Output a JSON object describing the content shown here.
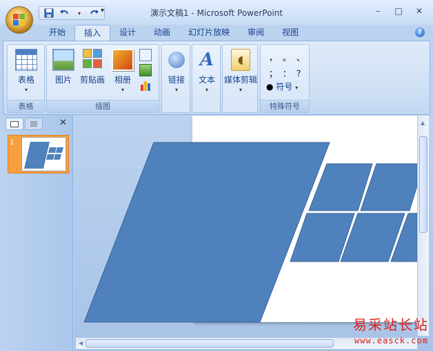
{
  "window": {
    "title": "演示文稿1 - Microsoft PowerPoint",
    "controls": {
      "minimize": "–",
      "maximize": "□",
      "close": "✕"
    }
  },
  "quick_access": {
    "more": "▾"
  },
  "tabs": [
    {
      "label": "开始"
    },
    {
      "label": "插入",
      "active": true
    },
    {
      "label": "设计"
    },
    {
      "label": "动画"
    },
    {
      "label": "幻灯片放映"
    },
    {
      "label": "审阅"
    },
    {
      "label": "视图"
    }
  ],
  "help_label": "?",
  "ribbon": {
    "groups": [
      {
        "label": "表格",
        "buttons": [
          {
            "label": "表格",
            "icon": "table-icon"
          }
        ]
      },
      {
        "label": "插图",
        "buttons": [
          {
            "label": "图片",
            "icon": "picture-icon"
          },
          {
            "label": "剪贴画",
            "icon": "clipart-icon"
          },
          {
            "label": "相册",
            "icon": "album-icon"
          }
        ]
      },
      {
        "label": "",
        "buttons": [
          {
            "label": "链接",
            "icon": "link-icon"
          }
        ]
      },
      {
        "label": "",
        "buttons": [
          {
            "label": "文本",
            "icon": "text-icon"
          }
        ]
      },
      {
        "label": "",
        "buttons": [
          {
            "label": "媒体剪辑",
            "icon": "media-icon"
          }
        ]
      },
      {
        "label": "特殊符号",
        "symbols": [
          "，",
          "。",
          "、",
          "；",
          "：",
          "？"
        ],
        "buttons": [
          {
            "label": "符号",
            "icon": "symbol-icon"
          }
        ]
      }
    ],
    "dropdown_arrow": "▾",
    "text_icon_glyph": "A",
    "media_icon_glyph": "◖"
  },
  "slides_panel": {
    "close": "✕",
    "slide_number": "1"
  },
  "watermark": {
    "text": "易采站长站",
    "url": "www.easck.com"
  },
  "colors": {
    "shape_fill": "#4f81bd",
    "shape_stroke": "#3a6499",
    "thumbnail_selected": "#f8a040",
    "ribbon_text": "#15428b"
  }
}
